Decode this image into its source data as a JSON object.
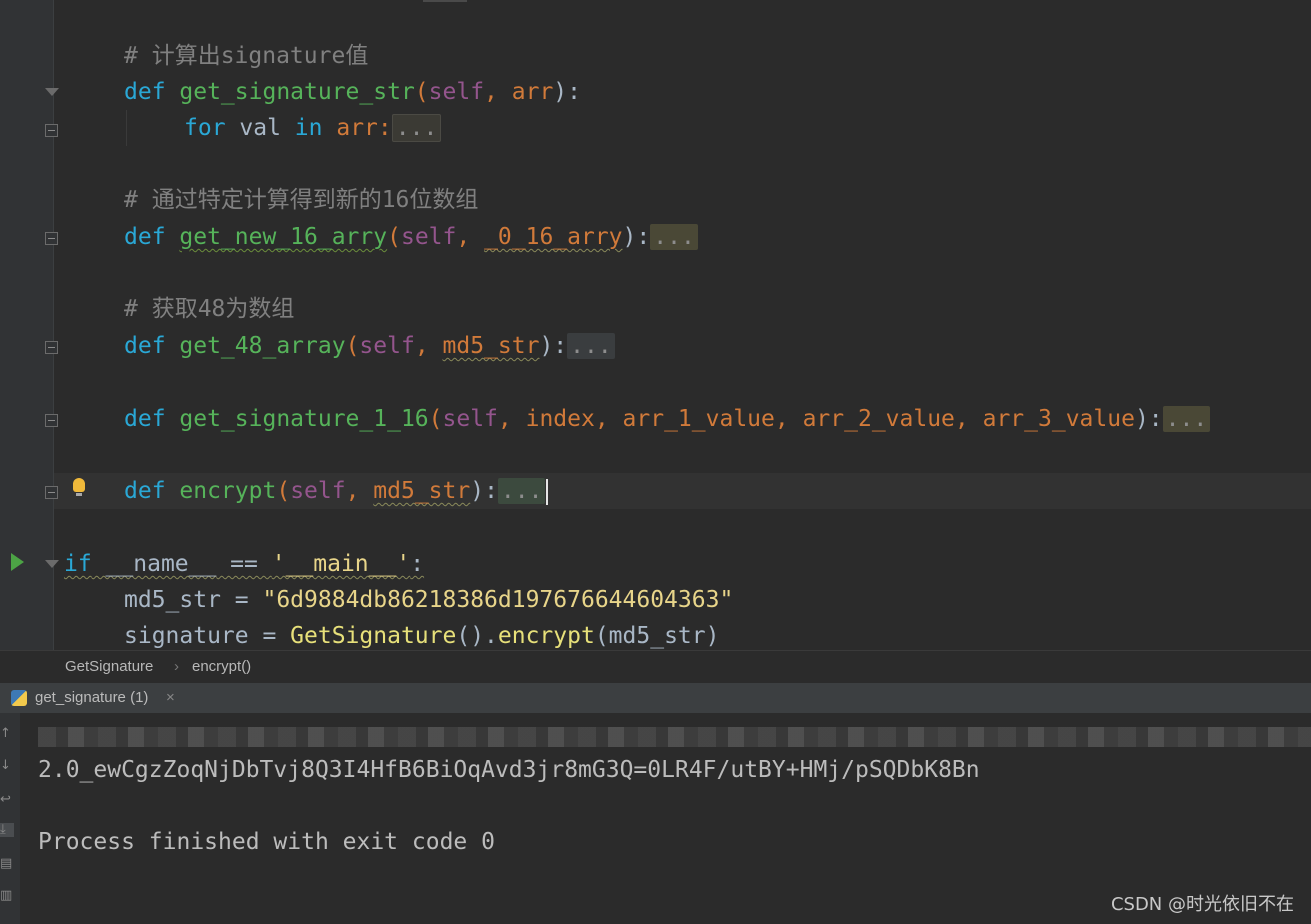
{
  "editor": {
    "lines": {
      "comment1": "# 计算出signature值",
      "def": "def ",
      "fn_get_signature_str": "get_signature_str",
      "paren_open": "(",
      "self": "self",
      "comma": ", ",
      "arr": "arr",
      "close_colon": "):",
      "for": "for",
      "val": " val ",
      "in": "in",
      "arr_colon": " arr:",
      "fold": "...",
      "comment2": "# 通过特定计算得到新的16位数组",
      "fn_get_new_16_arry": "get_new_16_arry",
      "p_0_16_arry": "_0_16_arry",
      "comment3": "# 获取48为数组",
      "fn_get_48_array": "get_48_array",
      "md5_str": "md5_str",
      "fn_get_signature_1_16": "get_signature_1_16",
      "index": "index",
      "arr_1_value": "arr_1_value",
      "arr_2_value": "arr_2_value",
      "arr_3_value": "arr_3_value",
      "fn_encrypt": "encrypt",
      "if": "if",
      "name_dunder": " __name__",
      "eq": " == ",
      "main_str": "'__main__'",
      "colon": ":",
      "md5_assign_lhs": "md5_str = ",
      "md5_value": "\"6d9884db86218386d197676644604363\"",
      "signature_lhs": "signature = ",
      "cls_GetSignature": "GetSignature",
      "call_mid": "().",
      "call_encrypt": "encrypt",
      "call_args": "(md5_str)"
    }
  },
  "breadcrumb": {
    "class_name": "GetSignature",
    "separator": "›",
    "method_name": "encrypt()"
  },
  "run_tab": {
    "label": "get_signature (1)",
    "close": "×"
  },
  "console": {
    "output_line": "2.0_ewCgzZoqNjDbTvj8Q3I4HfB6BiOqAvd3jr8mG3Q=0LR4F/utBY+HMj/pSQDbK8Bn",
    "exit_line": "Process finished with exit code 0"
  },
  "watermark": "CSDN @时光依旧不在",
  "colors": {
    "editor_bg": "#2b2b2b",
    "keyword": "#2aa8d6",
    "function": "#56b35a",
    "self": "#94558d",
    "param": "#d17a3a",
    "comment": "#808080",
    "string": "#e8d58a"
  }
}
